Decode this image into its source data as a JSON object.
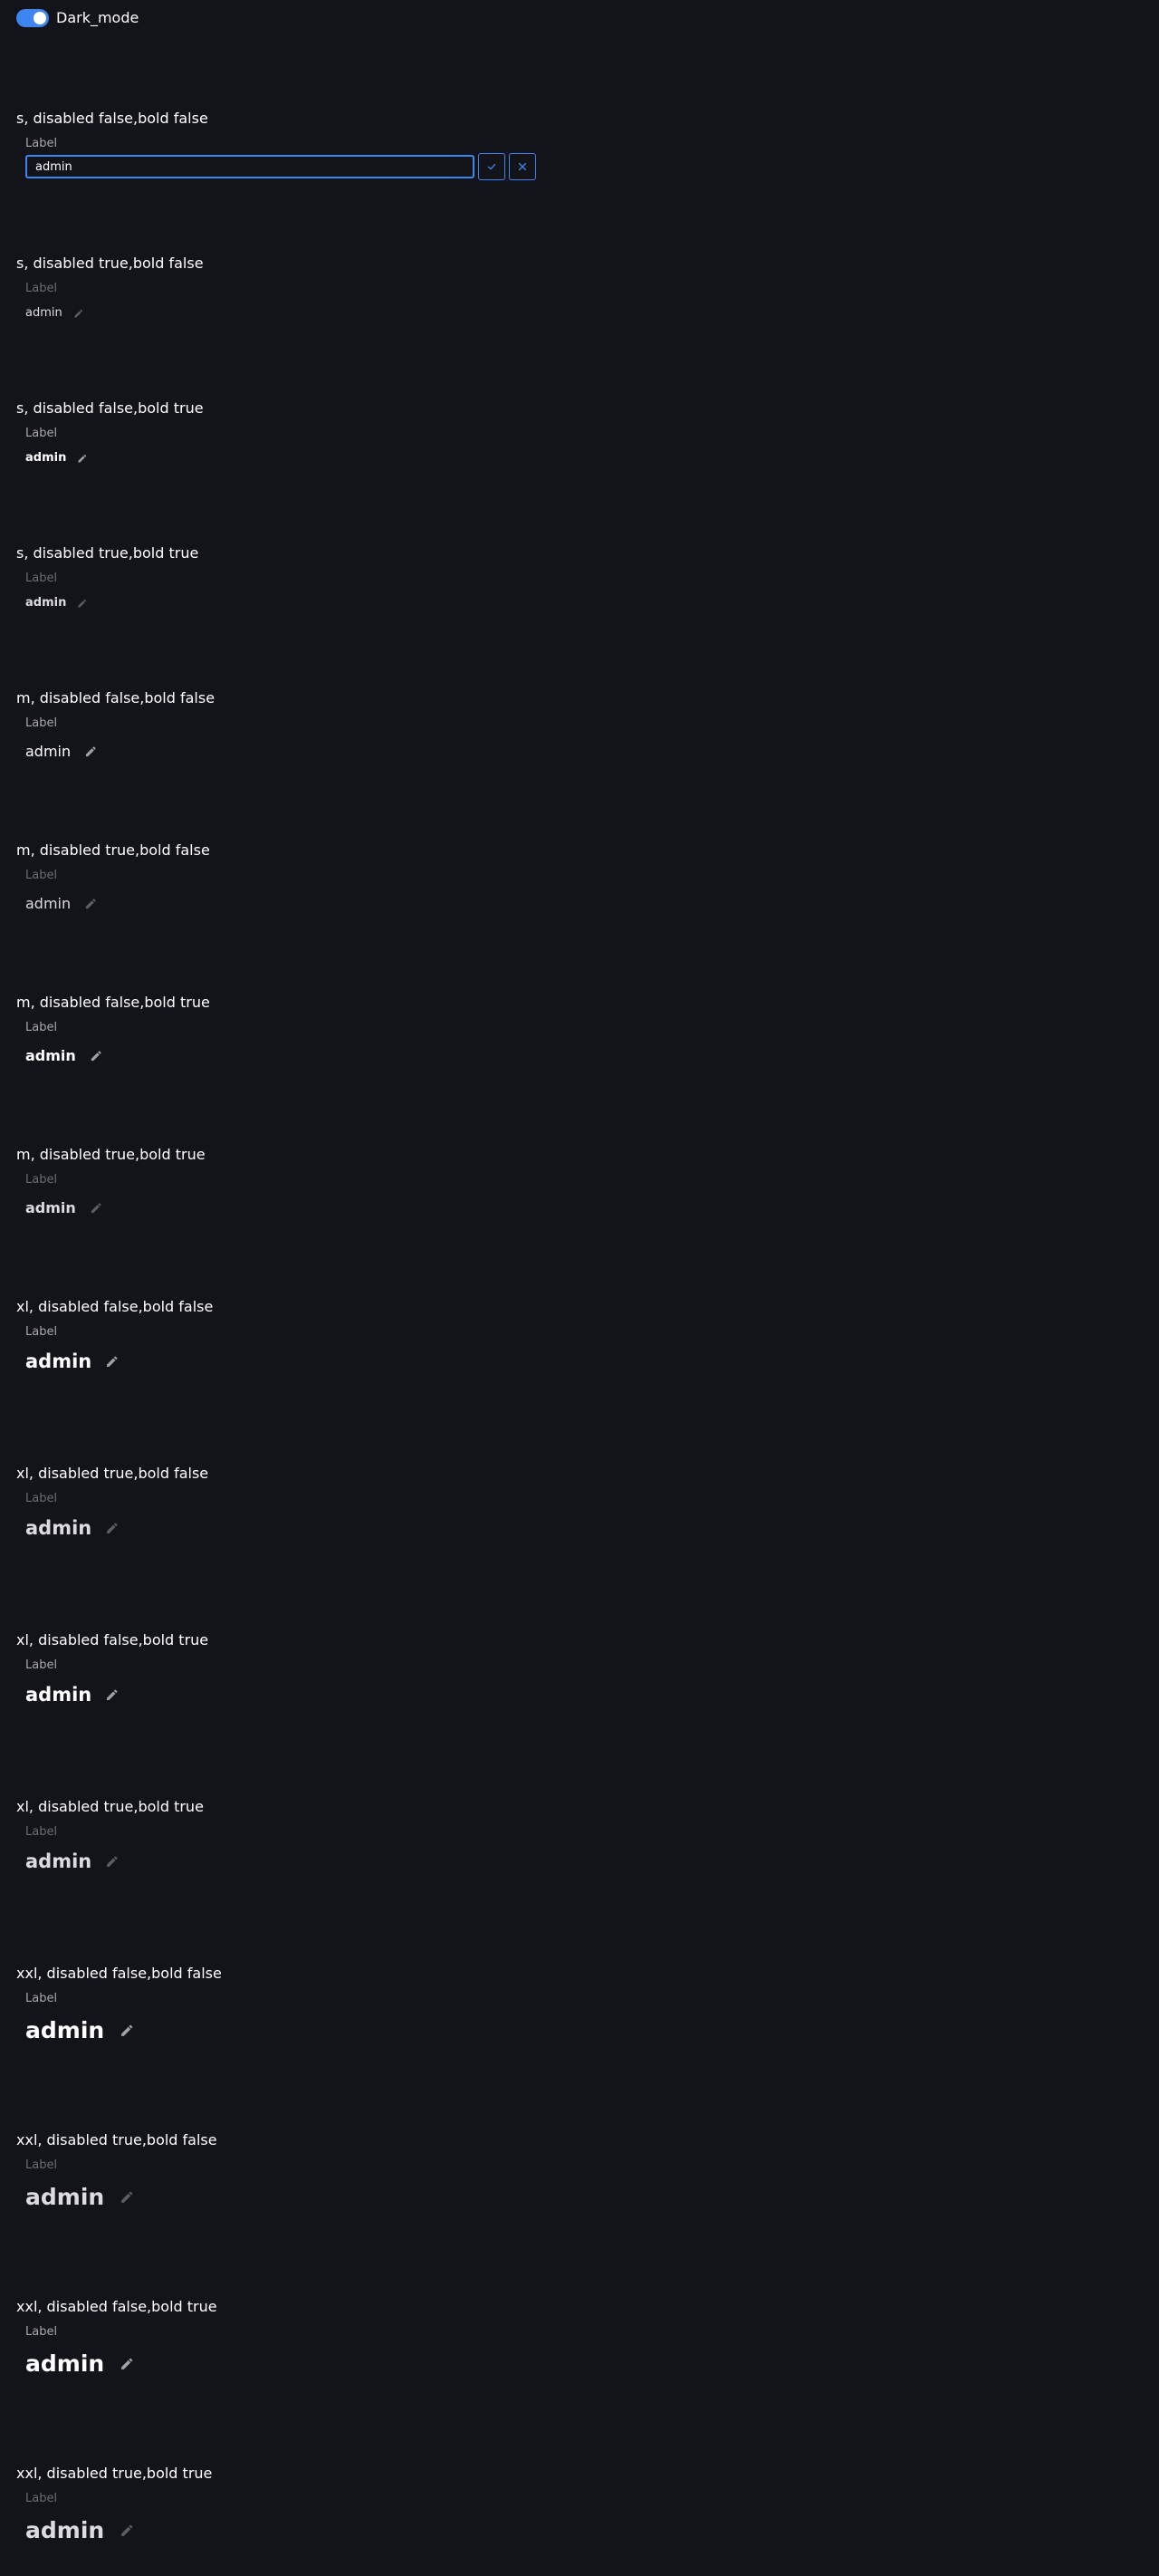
{
  "toggle": {
    "label": "Dark_mode",
    "on": true
  },
  "editing": {
    "title": "s, disabled false,bold false",
    "label": "Label",
    "value": "admin",
    "confirm_icon": "check-icon",
    "cancel_icon": "close-icon"
  },
  "rows": [
    {
      "title": "s, disabled true,bold false",
      "label": "Label",
      "value": "admin",
      "icon": "pencil-icon"
    },
    {
      "title": "s, disabled false,bold true",
      "label": "Label",
      "value": "admin",
      "icon": "pencil-icon"
    },
    {
      "title": "s, disabled true,bold true",
      "label": "Label",
      "value": "admin",
      "icon": "pencil-icon"
    },
    {
      "title": "m, disabled false,bold false",
      "label": "Label",
      "value": "admin",
      "icon": "pencil-icon"
    },
    {
      "title": "m, disabled true,bold false",
      "label": "Label",
      "value": "admin",
      "icon": "pencil-icon"
    },
    {
      "title": "m, disabled false,bold true",
      "label": "Label",
      "value": "admin",
      "icon": "pencil-icon"
    },
    {
      "title": "m, disabled true,bold true",
      "label": "Label",
      "value": "admin",
      "icon": "pencil-icon"
    },
    {
      "title": "xl, disabled false,bold false",
      "label": "Label",
      "value": "admin",
      "icon": "pencil-icon"
    },
    {
      "title": "xl, disabled true,bold false",
      "label": "Label",
      "value": "admin",
      "icon": "pencil-icon"
    },
    {
      "title": "xl, disabled false,bold true",
      "label": "Label",
      "value": "admin",
      "icon": "pencil-icon"
    },
    {
      "title": "xl, disabled true,bold true",
      "label": "Label",
      "value": "admin",
      "icon": "pencil-icon"
    },
    {
      "title": "xxl, disabled false,bold false",
      "label": "Label",
      "value": "admin",
      "icon": "pencil-icon"
    },
    {
      "title": "xxl, disabled true,bold false",
      "label": "Label",
      "value": "admin",
      "icon": "pencil-icon"
    },
    {
      "title": "xxl, disabled false,bold true",
      "label": "Label",
      "value": "admin",
      "icon": "pencil-icon"
    },
    {
      "title": "xxl, disabled true,bold true",
      "label": "Label",
      "value": "admin",
      "icon": "pencil-icon"
    }
  ],
  "colors": {
    "background": "#131419",
    "accent": "#3d86f1",
    "text": "#ffffff",
    "muted_label": "#a8a8ad",
    "disabled_label": "#6a6b70"
  }
}
